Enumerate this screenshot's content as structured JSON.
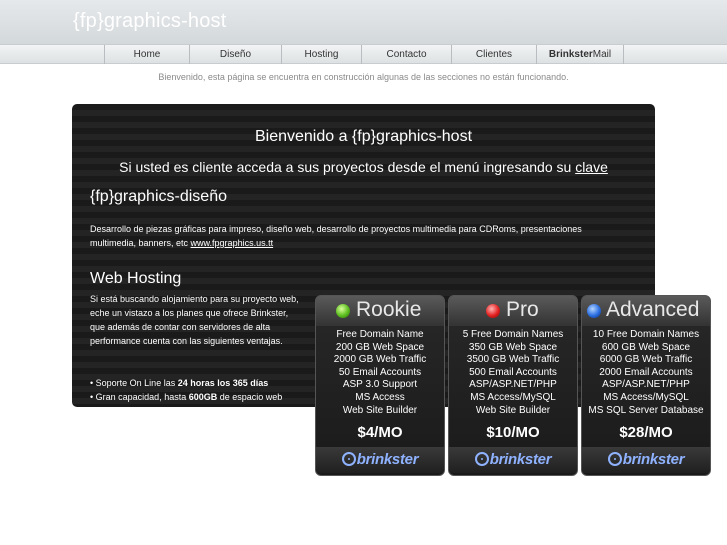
{
  "header": {
    "title": "{fp}graphics-host"
  },
  "nav": {
    "items": [
      "Home",
      "Diseño",
      "Hosting",
      "Contacto",
      "Clientes"
    ],
    "mail_bold": "Brinkster",
    "mail_rest": "Mail"
  },
  "notice": "Bienvenido, esta página se encuentra en construcción algunas de las secciones no están funcionando.",
  "panel": {
    "heading": "Bienvenido a {fp}graphics-host",
    "sub_text": "Si usted es cliente acceda a sus proyectos desde el menú ingresando su ",
    "sub_link": "clave",
    "design_title": "{fp}graphics-diseño",
    "design_text": "Desarrollo de piezas gráficas para impreso, diseño web, desarrollo de proyectos multimedia para CDRoms, presentaciones multimedia, banners, etc ",
    "design_link": "www.fpgraphics.us.tt",
    "hosting_title": "Web Hosting",
    "hosting_text": "Si está buscando alojamiento para su proyecto web, eche un vistazo a los planes que ofrece Brinkster, que además de contar con servidores de alta performance cuenta con las siguientes ventajas.",
    "bullet1_pre": "• Soporte On Line las ",
    "bullet1_bold": "24 horas los 365 días",
    "bullet2_pre": "• Gran capacidad, hasta ",
    "bullet2_bold": "600GB",
    "bullet2_post": " de espacio web"
  },
  "plans": [
    {
      "name": "Rookie",
      "dot": "green",
      "features": [
        "Free Domain Name",
        "200 GB Web Space",
        "2000 GB Web Traffic",
        "50 Email Accounts",
        "ASP 3.0 Support",
        "MS Access",
        "Web Site Builder"
      ],
      "price": "$4/MO",
      "brand": "brinkster"
    },
    {
      "name": "Pro",
      "dot": "red",
      "features": [
        "5 Free Domain Names",
        "350 GB Web Space",
        "3500 GB Web Traffic",
        "500 Email Accounts",
        "ASP/ASP.NET/PHP",
        "MS Access/MySQL",
        "Web Site Builder"
      ],
      "price": "$10/MO",
      "brand": "brinkster"
    },
    {
      "name": "Advanced",
      "dot": "blue",
      "features": [
        "10 Free Domain Names",
        "600 GB Web Space",
        "6000 GB Web Traffic",
        "2000 Email Accounts",
        "ASP/ASP.NET/PHP",
        "MS Access/MySQL",
        "MS SQL Server Database"
      ],
      "price": "$28/MO",
      "brand": "brinkster"
    }
  ],
  "colors": {
    "brand_blue": "#8fb2ff",
    "panel_bg": "#1a1a1a",
    "header_bg": "#d3d8db"
  }
}
